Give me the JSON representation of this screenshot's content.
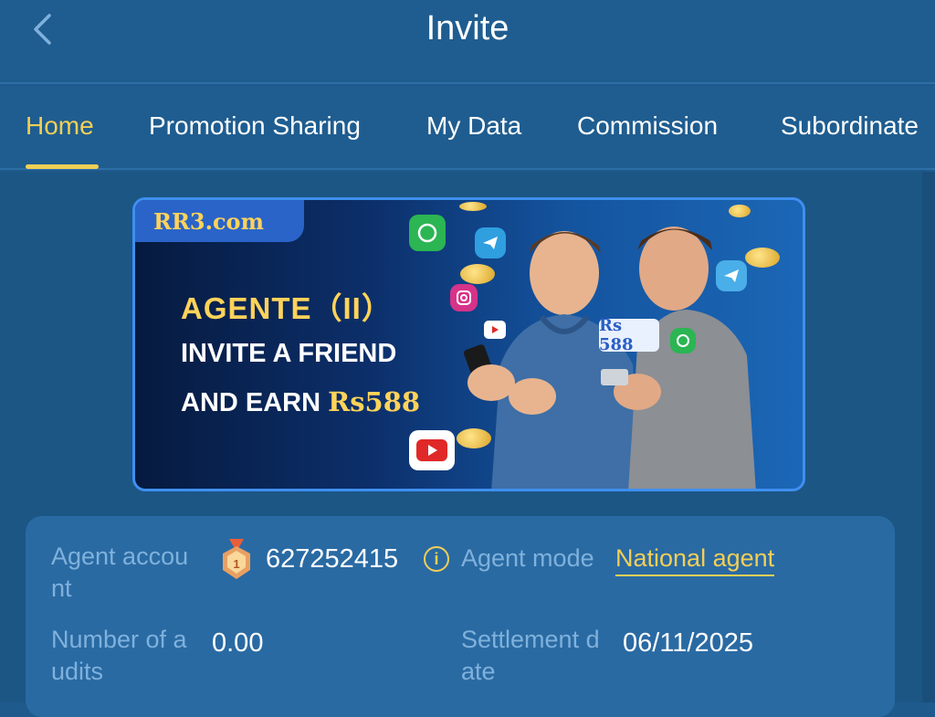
{
  "header": {
    "title": "Invite"
  },
  "tabs": [
    {
      "label": "Home"
    },
    {
      "label": "Promotion Sharing"
    },
    {
      "label": "My Data"
    },
    {
      "label": "Commission"
    },
    {
      "label": "Subordinate"
    }
  ],
  "banner": {
    "logo": "RR3.com",
    "title": "AGENTE（II）",
    "line1": "INVITE A FRIEND",
    "line2_prefix": "AND EARN ",
    "line2_amount": "Rs588",
    "price_bubble": "Rs 588"
  },
  "info": {
    "agent_account_label": "Agent accou nt",
    "agent_account_value": "627252415",
    "medal_level": "1",
    "agent_mode_label": "Agent mode",
    "agent_mode_value": "National agent",
    "audits_label": "Number of a udits",
    "audits_value": "0.00",
    "settlement_label": "Settlement d ate",
    "settlement_value": "06/11/2025"
  },
  "colors": {
    "accent": "#f2cf56",
    "background": "#1e5a8c",
    "card": "#2a6aa3",
    "label": "#7fb1dc"
  }
}
